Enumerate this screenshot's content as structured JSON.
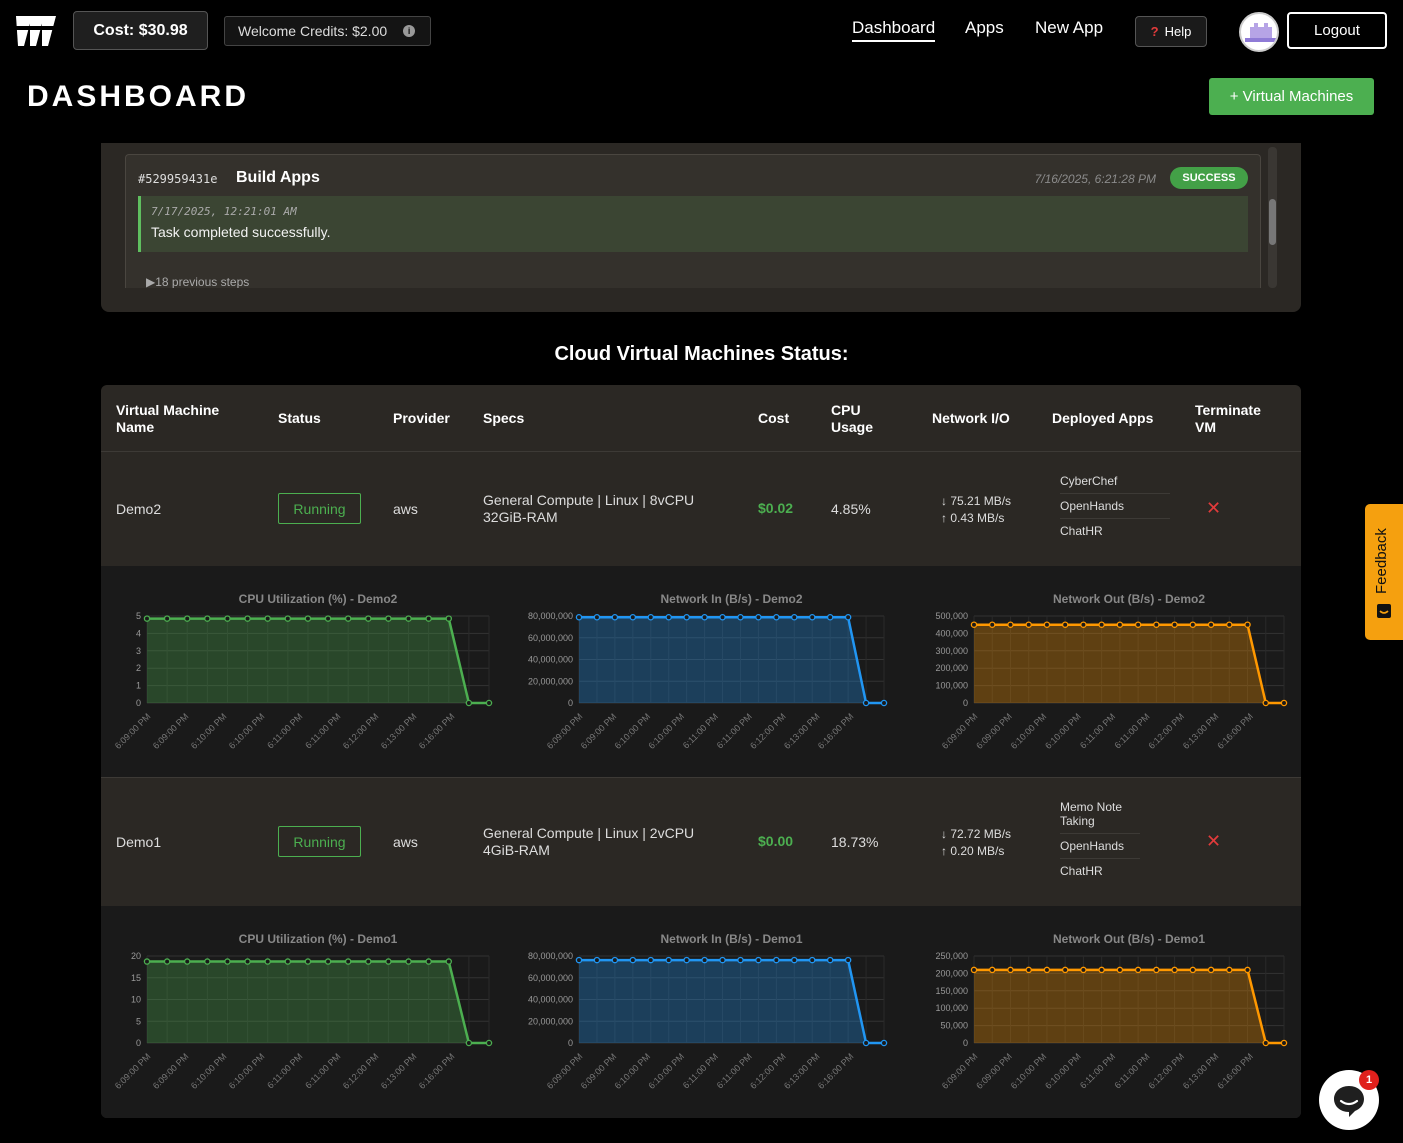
{
  "header": {
    "cost_label": "Cost: $30.98",
    "credits_label": "Welcome Credits: $2.00",
    "nav": [
      "Dashboard",
      "Apps",
      "New App"
    ],
    "help_label": "Help",
    "logout_label": "Logout"
  },
  "page": {
    "title": "DASHBOARD",
    "add_vm_label": "+ Virtual Machines"
  },
  "task": {
    "id": "#529959431e",
    "name": "Build Apps",
    "timestamp": "7/16/2025, 6:21:28 PM",
    "status": "SUCCESS",
    "log_time": "7/17/2025, 12:21:01 AM",
    "log_message": "Task completed successfully.",
    "previous_steps": "▶18 previous steps"
  },
  "vm_section": {
    "title": "Cloud Virtual Machines Status:",
    "headers": [
      "Virtual Machine Name",
      "Status",
      "Provider",
      "Specs",
      "Cost",
      "CPU Usage",
      "Network I/O",
      "Deployed Apps",
      "Terminate VM"
    ],
    "vms": [
      {
        "name": "Demo2",
        "status": "Running",
        "provider": "aws",
        "specs_line1": "General Compute | Linux | 8vCPU",
        "specs_line2": "32GiB-RAM",
        "cost": "$0.02",
        "cpu": "4.85%",
        "net_in": "↓ 75.21 MB/s",
        "net_out": "↑ 0.43 MB/s",
        "apps": [
          "CyberChef",
          "OpenHands",
          "ChatHR"
        ]
      },
      {
        "name": "Demo1",
        "status": "Running",
        "provider": "aws",
        "specs_line1": "General Compute | Linux | 2vCPU",
        "specs_line2": "4GiB-RAM",
        "cost": "$0.00",
        "cpu": "18.73%",
        "net_in": "↓ 72.72 MB/s",
        "net_out": "↑ 0.20 MB/s",
        "apps": [
          "Memo Note Taking",
          "OpenHands",
          "ChatHR"
        ]
      }
    ]
  },
  "feedback_label": "Feedback",
  "chat_badge": "1",
  "colors": {
    "cpu": "#4caf50",
    "net_in": "#2196f3",
    "net_out": "#ff9800",
    "accent": "#4caf50"
  },
  "chart_data": [
    {
      "type": "area",
      "title": "CPU Utilization (%) - Demo2",
      "color": "#4caf50",
      "x": [
        "6:09:00 PM",
        "6:09:00 PM",
        "6:10:00 PM",
        "6:10:00 PM",
        "6:11:00 PM",
        "6:11:00 PM",
        "6:12:00 PM",
        "6:13:00 PM",
        "6:16:00 PM"
      ],
      "yticks": [
        "0",
        "1",
        "2",
        "3",
        "4",
        "5"
      ],
      "ylim": [
        0,
        5
      ],
      "values": [
        4.85,
        4.85,
        4.85,
        4.85,
        4.85,
        4.85,
        4.85,
        4.85,
        4.85,
        4.85,
        4.85,
        4.85,
        4.85,
        4.85,
        4.85,
        4.85,
        0,
        0
      ]
    },
    {
      "type": "area",
      "title": "Network In (B/s) - Demo2",
      "color": "#2196f3",
      "x": [
        "6:09:00 PM",
        "6:09:00 PM",
        "6:10:00 PM",
        "6:10:00 PM",
        "6:11:00 PM",
        "6:11:00 PM",
        "6:12:00 PM",
        "6:13:00 PM",
        "6:16:00 PM"
      ],
      "yticks": [
        "0",
        "20,000,000",
        "40,000,000",
        "60,000,000",
        "80,000,000"
      ],
      "ylim": [
        0,
        80000000
      ],
      "values": [
        78860000,
        78860000,
        78860000,
        78860000,
        78860000,
        78860000,
        78860000,
        78860000,
        78860000,
        78860000,
        78860000,
        78860000,
        78860000,
        78860000,
        78860000,
        78860000,
        0,
        0
      ]
    },
    {
      "type": "area",
      "title": "Network Out (B/s) - Demo2",
      "color": "#ff9800",
      "x": [
        "6:09:00 PM",
        "6:09:00 PM",
        "6:10:00 PM",
        "6:10:00 PM",
        "6:11:00 PM",
        "6:11:00 PM",
        "6:12:00 PM",
        "6:13:00 PM",
        "6:16:00 PM"
      ],
      "yticks": [
        "0",
        "100,000",
        "200,000",
        "300,000",
        "400,000",
        "500,000"
      ],
      "ylim": [
        0,
        500000
      ],
      "values": [
        450000,
        450000,
        450000,
        450000,
        450000,
        450000,
        450000,
        450000,
        450000,
        450000,
        450000,
        450000,
        450000,
        450000,
        450000,
        450000,
        0,
        0
      ]
    },
    {
      "type": "area",
      "title": "CPU Utilization (%) - Demo1",
      "color": "#4caf50",
      "x": [
        "6:09:00 PM",
        "6:09:00 PM",
        "6:10:00 PM",
        "6:10:00 PM",
        "6:11:00 PM",
        "6:11:00 PM",
        "6:12:00 PM",
        "6:13:00 PM",
        "6:16:00 PM"
      ],
      "yticks": [
        "0",
        "5",
        "10",
        "15",
        "20"
      ],
      "ylim": [
        0,
        20
      ],
      "values": [
        18.73,
        18.73,
        18.73,
        18.73,
        18.73,
        18.73,
        18.73,
        18.73,
        18.73,
        18.73,
        18.73,
        18.73,
        18.73,
        18.73,
        18.73,
        18.73,
        0,
        0
      ]
    },
    {
      "type": "area",
      "title": "Network In (B/s) - Demo1",
      "color": "#2196f3",
      "x": [
        "6:09:00 PM",
        "6:09:00 PM",
        "6:10:00 PM",
        "6:10:00 PM",
        "6:11:00 PM",
        "6:11:00 PM",
        "6:12:00 PM",
        "6:13:00 PM",
        "6:16:00 PM"
      ],
      "yticks": [
        "0",
        "20,000,000",
        "40,000,000",
        "60,000,000",
        "80,000,000"
      ],
      "ylim": [
        0,
        80000000
      ],
      "values": [
        76250000,
        76250000,
        76250000,
        76250000,
        76250000,
        76250000,
        76250000,
        76250000,
        76250000,
        76250000,
        76250000,
        76250000,
        76250000,
        76250000,
        76250000,
        76250000,
        0,
        0
      ]
    },
    {
      "type": "area",
      "title": "Network Out (B/s) - Demo1",
      "color": "#ff9800",
      "x": [
        "6:09:00 PM",
        "6:09:00 PM",
        "6:10:00 PM",
        "6:10:00 PM",
        "6:11:00 PM",
        "6:11:00 PM",
        "6:12:00 PM",
        "6:13:00 PM",
        "6:16:00 PM"
      ],
      "yticks": [
        "0",
        "50,000",
        "100,000",
        "150,000",
        "200,000",
        "250,000"
      ],
      "ylim": [
        0,
        250000
      ],
      "values": [
        210000,
        210000,
        210000,
        210000,
        210000,
        210000,
        210000,
        210000,
        210000,
        210000,
        210000,
        210000,
        210000,
        210000,
        210000,
        210000,
        0,
        0
      ]
    }
  ]
}
